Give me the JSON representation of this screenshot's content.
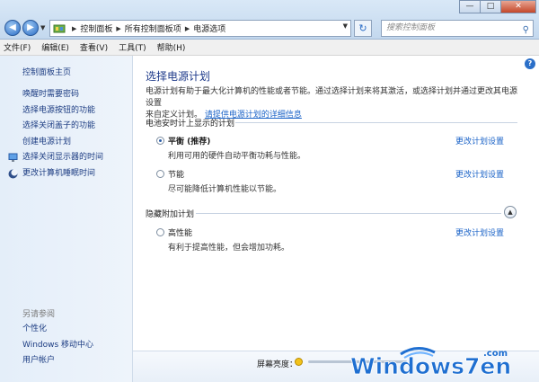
{
  "window": {
    "minimize_glyph": "—",
    "maximize_glyph": "□",
    "close_glyph": "✕"
  },
  "address": {
    "breadcrumbs": [
      "控制面板",
      "所有控制面板项",
      "电源选项"
    ],
    "search_placeholder": "搜索控制面板"
  },
  "menubar": [
    "文件(F)",
    "编辑(E)",
    "查看(V)",
    "工具(T)",
    "帮助(H)"
  ],
  "sidebar": {
    "home": "控制面板主页",
    "items": [
      {
        "label": "唤醒时需要密码",
        "icon": ""
      },
      {
        "label": "选择电源按钮的功能",
        "icon": ""
      },
      {
        "label": "选择关闭盖子的功能",
        "icon": ""
      },
      {
        "label": "创建电源计划",
        "icon": ""
      },
      {
        "label": "选择关闭显示器的时间",
        "icon": "monitor-icon"
      },
      {
        "label": "更改计算机睡眠时间",
        "icon": "moon-icon"
      }
    ],
    "see_also": "另请参阅",
    "see_also_items": [
      "个性化",
      "Windows 移动中心",
      "用户帐户"
    ]
  },
  "main": {
    "title": "选择电源计划",
    "desc_line1": "电源计划有助于最大化计算机的性能或者节能。通过选择计划来将其激活，或选择计划并通过更改其电源设置",
    "desc_line2_prefix": "来自定义计划。",
    "desc_link": "请提供电源计划的详细信息",
    "section_battery": "电池安时计上显示的计划",
    "section_hidden": "隐藏附加计划",
    "plans": [
      {
        "name": "平衡 (推荐)",
        "desc": "利用可用的硬件自动平衡功耗与性能。",
        "link": "更改计划设置",
        "selected": true
      },
      {
        "name": "节能",
        "desc": "尽可能降低计算机性能以节能。",
        "link": "更改计划设置",
        "selected": false
      },
      {
        "name": "高性能",
        "desc": "有利于提高性能，但会增加功耗。",
        "link": "更改计划设置",
        "selected": false
      }
    ]
  },
  "bottom": {
    "brightness_label": "屏幕亮度："
  },
  "watermark": {
    "text": "Windows7en",
    "suffix": ".com"
  },
  "colors": {
    "link": "#1c64c8",
    "nav_link": "#1c3c82",
    "title": "#1e3a8a",
    "watermark_blue": "#1f6fd1"
  }
}
